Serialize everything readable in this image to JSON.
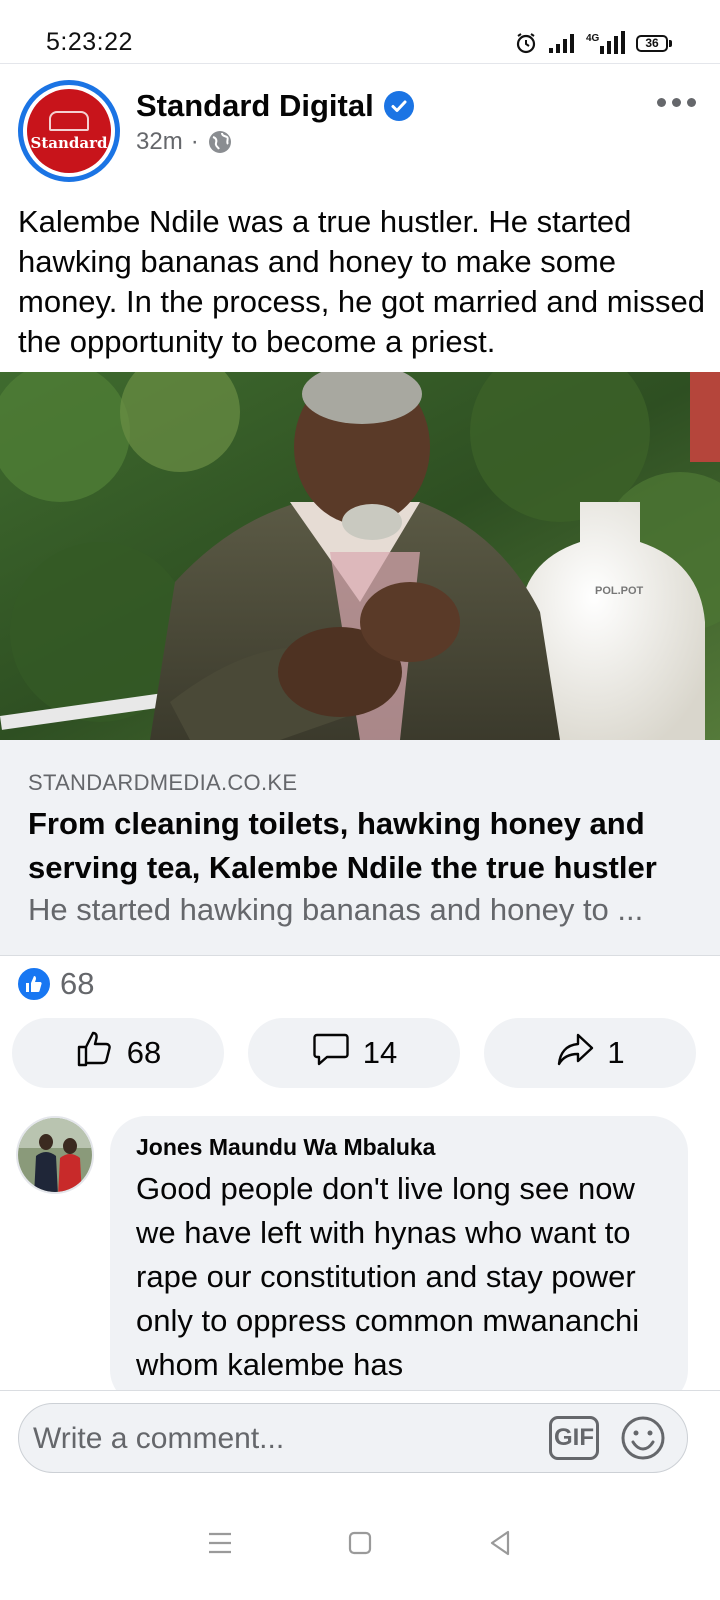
{
  "status_bar": {
    "time": "5:23:22",
    "network": "4G",
    "battery": "36"
  },
  "post": {
    "page_name": "Standard Digital",
    "logo_text": "Standard",
    "time_ago": "32m",
    "meta_separator": "·",
    "text": "Kalembe Ndile was a true hustler. He started hawking bananas and honey to make some money. In the process, he got married and missed the opportunity to become a priest.",
    "image_tank_label": "POL.POT"
  },
  "link_preview": {
    "domain": "STANDARDMEDIA.CO.KE",
    "title": "From cleaning toilets, hawking honey and serving tea, Kalembe Ndile the true hustler",
    "description": "He started hawking bananas and honey to ..."
  },
  "reactions": {
    "count": "68"
  },
  "actions": {
    "like_count": "68",
    "comment_count": "14",
    "share_count": "1"
  },
  "comment": {
    "author": "Jones Maundu Wa Mbaluka",
    "text": "Good people don't live long see now we have left with hynas who want to rape our constitution and stay power only to oppress common mwananchi whom kalembe has"
  },
  "composer": {
    "placeholder": "Write a comment...",
    "gif_label": "GIF"
  },
  "colors": {
    "brand_blue": "#1877f2",
    "standard_red": "#c8141b",
    "secondary_text": "#65676b",
    "surface_gray": "#f0f2f5"
  },
  "icons": [
    "alarm-icon",
    "signal-icon",
    "network-4g-icon",
    "battery-icon",
    "verified-badge-icon",
    "globe-icon",
    "more-options-icon",
    "like-reaction-icon",
    "thumbs-up-icon",
    "comment-icon",
    "share-icon",
    "gif-icon",
    "emoji-icon",
    "menu-nav-icon",
    "home-nav-icon",
    "back-nav-icon"
  ]
}
